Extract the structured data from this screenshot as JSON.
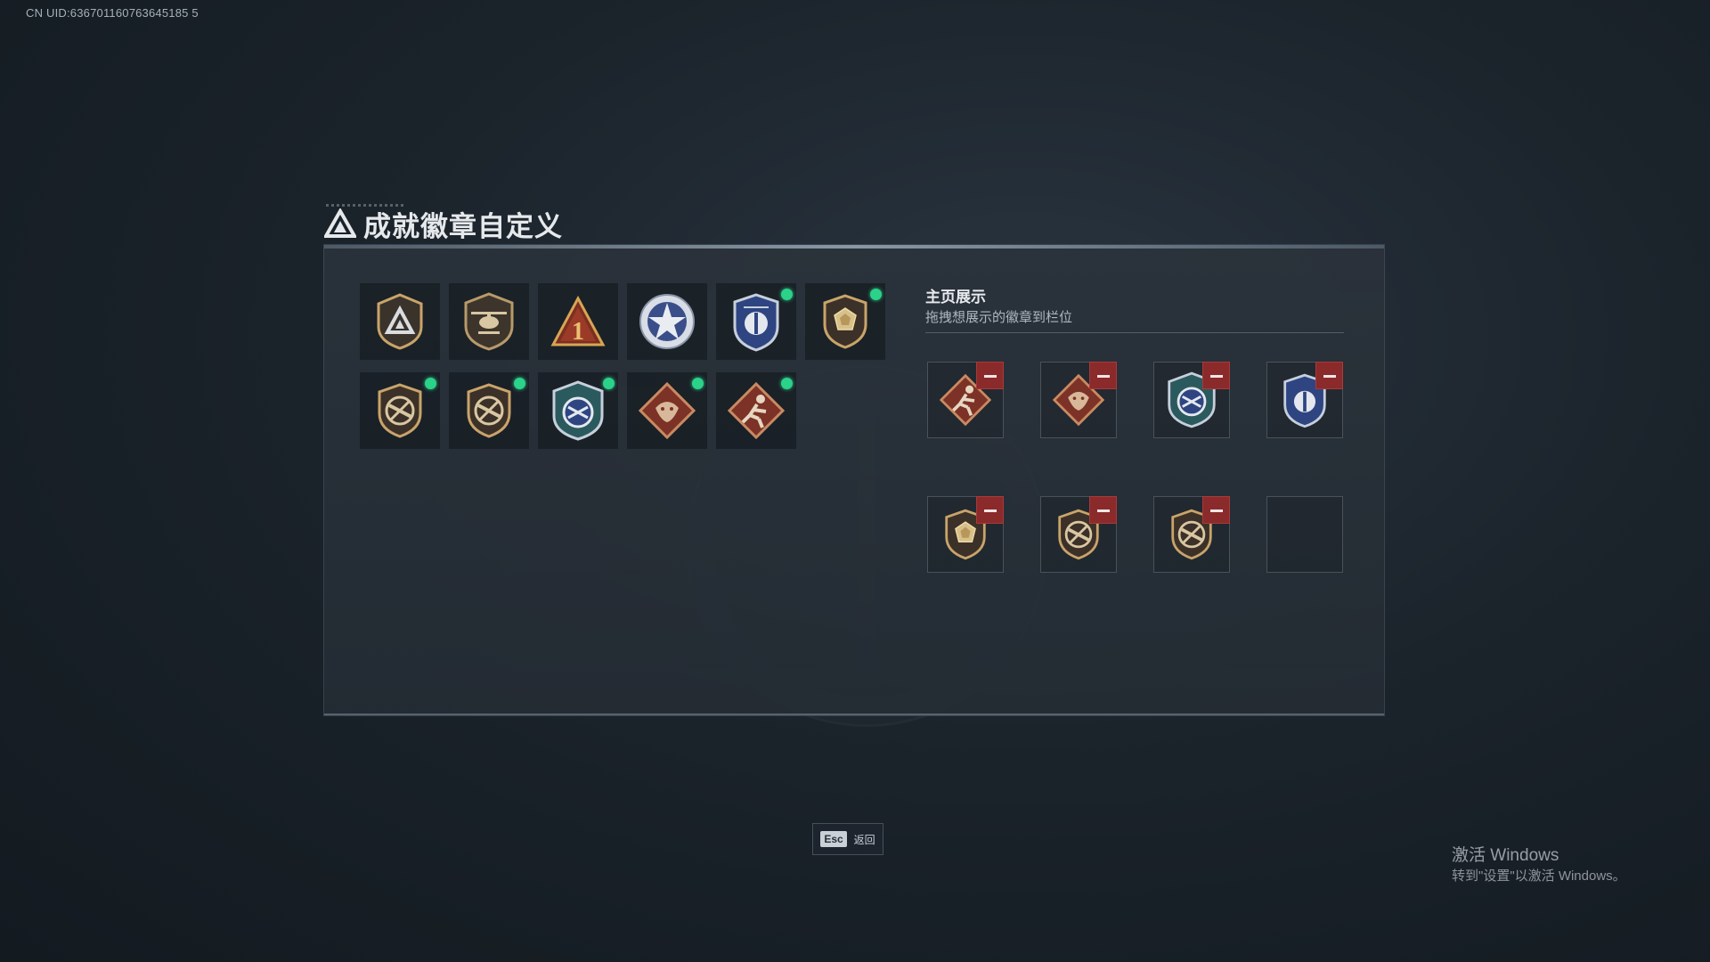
{
  "uid": "CN UID:636701160763645185 5",
  "title": "成就徽章自定义",
  "display": {
    "title": "主页展示",
    "subtitle": "拖拽想展示的徽章到栏位"
  },
  "badges": [
    {
      "icon": "triangle-shield-badge",
      "new": false
    },
    {
      "icon": "helicopter-shield-badge",
      "new": false
    },
    {
      "icon": "rank-one-badge",
      "new": false
    },
    {
      "icon": "star-emblem-badge",
      "new": false
    },
    {
      "icon": "blue-shield-badge",
      "new": true
    },
    {
      "icon": "gem-shield-badge",
      "new": true
    },
    {
      "icon": "no-rifle-shield-badge",
      "new": true
    },
    {
      "icon": "no-rifle-shield-badge",
      "new": true
    },
    {
      "icon": "arrows-blue-shield-badge",
      "new": true
    },
    {
      "icon": "dragon-diamond-badge",
      "new": true
    },
    {
      "icon": "runner-diamond-badge",
      "new": true
    }
  ],
  "display_slots": [
    {
      "icon": "runner-diamond-badge",
      "removable": true
    },
    {
      "icon": "dragon-diamond-badge",
      "removable": true
    },
    {
      "icon": "arrows-blue-shield-badge",
      "removable": true
    },
    {
      "icon": "blue-shield-badge",
      "removable": true
    },
    {
      "icon": "gem-shield-badge",
      "removable": true
    },
    {
      "icon": "no-rifle-shield-badge",
      "removable": true
    },
    {
      "icon": "no-rifle-shield-badge",
      "removable": true
    },
    {
      "icon": "empty-slot",
      "removable": false
    }
  ],
  "footer": {
    "esc_key": "Esc",
    "esc_label": "返回"
  },
  "watermark": {
    "line1": "激活 Windows",
    "line2": "转到\"设置\"以激活 Windows。"
  },
  "colors": {
    "new_dot": "#2ad28a",
    "remove_button": "#8b2a2a",
    "badge_gold": "#c9a46a",
    "badge_blue": "#3b5aa8",
    "badge_red": "#8c3a2e"
  }
}
